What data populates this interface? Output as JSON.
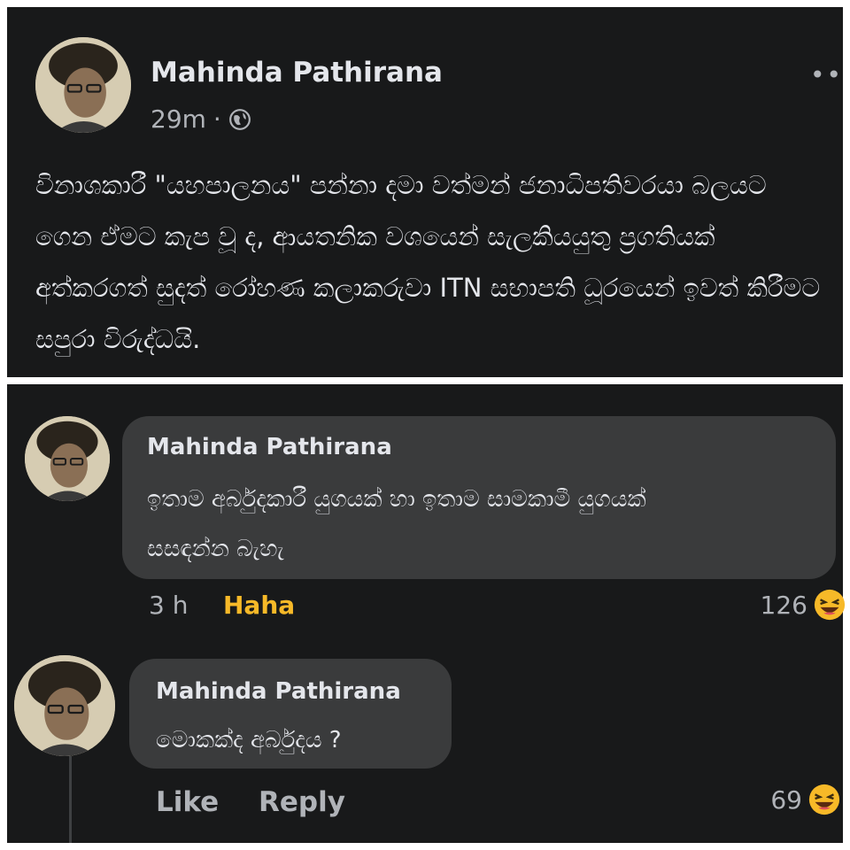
{
  "post": {
    "author": "Mahinda Pathirana",
    "time": "29m",
    "separator": "·",
    "text": "විනාශකාරී \"යහපාලනය\" පන්නා දමා වත්මන් ජනාධිපතිවරයා බලයට ගෙන ඒමට කැප වූ ද, ආයතනික වශයෙන් සැලකියයුතු ප්‍රගතියක් අත්කරගත් සුදත් රෝහණ කලාකරුවා ITN සභාපති ධූරයෙන් ඉවත් කිරීමට සපුරා විරුද්ධයි."
  },
  "comments": [
    {
      "author": "Mahinda Pathirana",
      "text_line1": "ඉතාම අර්බුදකාරී යුගයක් හා ඉතාම සාමකාමී යුගයක්",
      "text_line2": "සසඳන්න බැහැ",
      "time": "3 h",
      "reaction_label": "Haha",
      "reaction_count": "126"
    },
    {
      "author": "Mahinda Pathirana",
      "text": "මොකක්ද අර්බුදය ?",
      "like_label": "Like",
      "reply_label": "Reply",
      "reaction_count": "69"
    }
  ],
  "icons": {
    "globe": "globe-icon",
    "more": "more-options-icon",
    "reaction": "haha-emoji-icon"
  },
  "colors": {
    "background": "#18191a",
    "bubble": "#3a3b3c",
    "text": "#e4e6eb",
    "secondary": "#b0b3b8",
    "haha": "#f7b928"
  }
}
